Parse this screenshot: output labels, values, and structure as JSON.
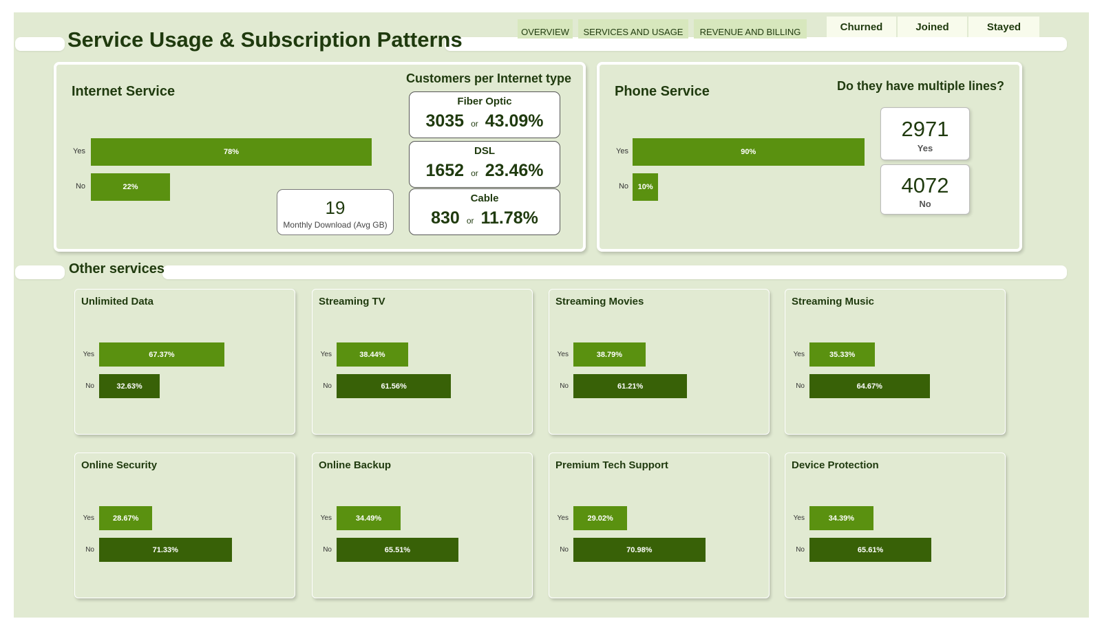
{
  "page": {
    "title": "Service Usage & Subscription Patterns",
    "nav_tabs": [
      "OVERVIEW",
      "SERVICES AND USAGE",
      "REVENUE AND BILLING"
    ],
    "status_filters": [
      "Churned",
      "Joined",
      "Stayed"
    ]
  },
  "colors": {
    "background": "#e1ead2",
    "bar_yes": "#5a9110",
    "bar_no": "#386107",
    "title_text": "#1f3a0e"
  },
  "internet": {
    "title": "Internet Service",
    "bars": [
      {
        "label": "Yes",
        "value": 78,
        "text": "78%"
      },
      {
        "label": "No",
        "value": 22,
        "text": "22%"
      }
    ],
    "avg_download": {
      "value": "19",
      "label": "Monthly Download (Avg GB)"
    },
    "types_title": "Customers per Internet type",
    "types": [
      {
        "name": "Fiber Optic",
        "count": "3035",
        "or": "or",
        "pct": "43.09%"
      },
      {
        "name": "DSL",
        "count": "1652",
        "or": "or",
        "pct": "23.46%"
      },
      {
        "name": "Cable",
        "count": "830",
        "or": "or",
        "pct": "11.78%"
      }
    ]
  },
  "phone": {
    "title": "Phone Service",
    "bars": [
      {
        "label": "Yes",
        "value": 90,
        "text": "90%"
      },
      {
        "label": "No",
        "value": 10,
        "text": "10%"
      }
    ],
    "multi_title": "Do they have multiple lines?",
    "multi": [
      {
        "value": "2971",
        "label": "Yes"
      },
      {
        "value": "4072",
        "label": "No"
      }
    ]
  },
  "other": {
    "title": "Other services",
    "services": [
      {
        "name": "Unlimited Data",
        "yes": 67.37,
        "yes_text": "67.37%",
        "no": 32.63,
        "no_text": "32.63%"
      },
      {
        "name": "Streaming TV",
        "yes": 38.44,
        "yes_text": "38.44%",
        "no": 61.56,
        "no_text": "61.56%"
      },
      {
        "name": "Streaming Movies",
        "yes": 38.79,
        "yes_text": "38.79%",
        "no": 61.21,
        "no_text": "61.21%"
      },
      {
        "name": "Streaming Music",
        "yes": 35.33,
        "yes_text": "35.33%",
        "no": 64.67,
        "no_text": "64.67%"
      },
      {
        "name": "Online Security",
        "yes": 28.67,
        "yes_text": "28.67%",
        "no": 71.33,
        "no_text": "71.33%"
      },
      {
        "name": "Online Backup",
        "yes": 34.49,
        "yes_text": "34.49%",
        "no": 65.51,
        "no_text": "65.51%"
      },
      {
        "name": "Premium Tech Support",
        "yes": 29.02,
        "yes_text": "29.02%",
        "no": 70.98,
        "no_text": "70.98%"
      },
      {
        "name": "Device Protection",
        "yes": 34.39,
        "yes_text": "34.39%",
        "no": 65.61,
        "no_text": "65.61%"
      }
    ],
    "yes_label": "Yes",
    "no_label": "No"
  }
}
